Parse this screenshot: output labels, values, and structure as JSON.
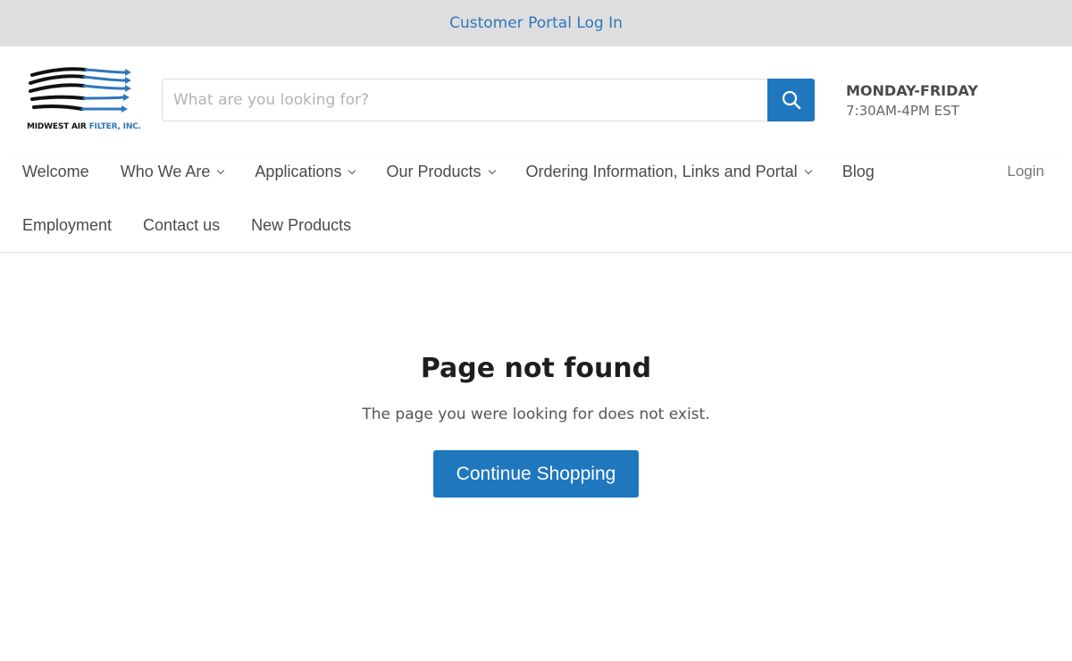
{
  "topbar": {
    "link": "Customer Portal Log In"
  },
  "logo": {
    "text_black": "MIDWEST AIR ",
    "text_blue": "FILTER, INC."
  },
  "search": {
    "placeholder": "What are you looking for?"
  },
  "hours": {
    "days": "MONDAY-FRIDAY",
    "time": "7:30AM-4PM EST"
  },
  "nav": {
    "row1": [
      {
        "label": "Welcome",
        "dropdown": false
      },
      {
        "label": "Who We Are",
        "dropdown": true
      },
      {
        "label": "Applications",
        "dropdown": true
      },
      {
        "label": "Our Products",
        "dropdown": true
      },
      {
        "label": "Ordering Information, Links and Portal",
        "dropdown": true
      },
      {
        "label": "Blog",
        "dropdown": false
      }
    ],
    "row2": [
      {
        "label": "Employment",
        "dropdown": false
      },
      {
        "label": "Contact us",
        "dropdown": false
      },
      {
        "label": "New Products",
        "dropdown": false
      }
    ],
    "login": "Login"
  },
  "main": {
    "title": "Page not found",
    "message": "The page you were looking for does not exist.",
    "button": "Continue Shopping"
  },
  "colors": {
    "accent": "#1f77be",
    "link": "#2e77bc",
    "topbar_bg": "#dedede"
  }
}
